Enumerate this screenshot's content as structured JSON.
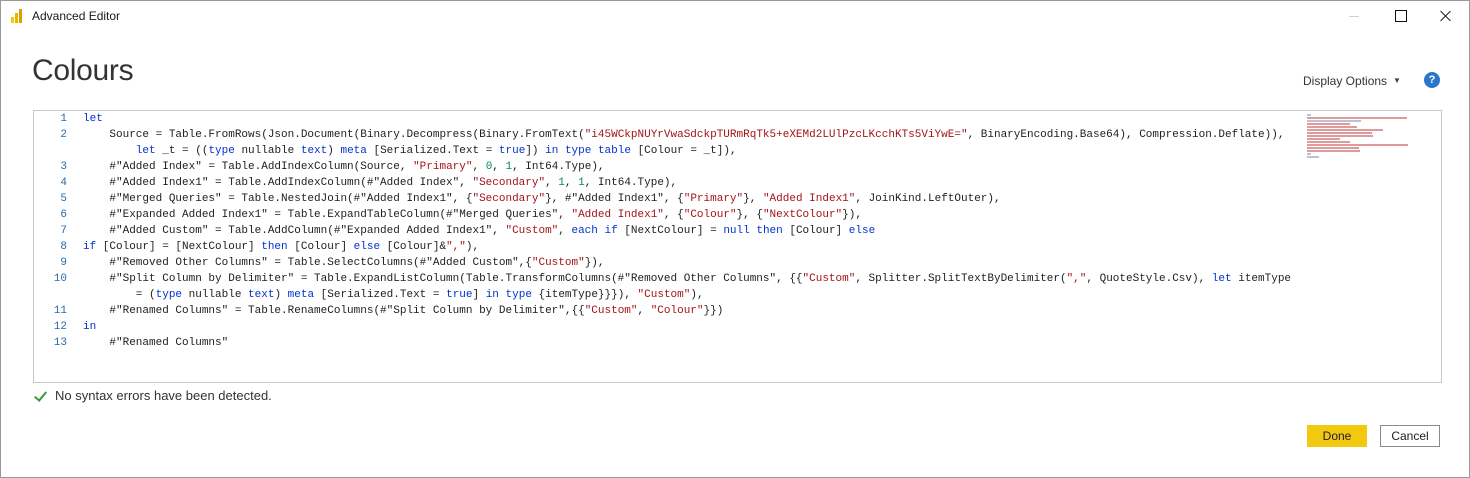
{
  "window": {
    "title": "Advanced Editor"
  },
  "header": {
    "query_name": "Colours",
    "display_options_label": "Display Options",
    "help_icon": "question-circle-icon"
  },
  "editor": {
    "lines": [
      {
        "number": "1",
        "tokens": [
          {
            "t": "kw",
            "v": "let"
          }
        ]
      },
      {
        "number": "2",
        "tokens": [
          {
            "t": "",
            "v": "    Source = Table.FromRows(Json.Document(Binary.Decompress(Binary.FromText("
          },
          {
            "t": "st",
            "v": "\"i45WCkpNUYrVwaSdckpTURmRqTk5+eXEMd2LUlPzcLKcchKTs5ViYwE=\""
          },
          {
            "t": "",
            "v": ", BinaryEncoding.Base64), Compression.Deflate)),"
          }
        ]
      },
      {
        "number": "",
        "tokens": [
          {
            "t": "",
            "v": "        "
          },
          {
            "t": "kw",
            "v": "let"
          },
          {
            "t": "",
            "v": " _t = (("
          },
          {
            "t": "kw",
            "v": "type"
          },
          {
            "t": "",
            "v": " nullable "
          },
          {
            "t": "kw",
            "v": "text"
          },
          {
            "t": "",
            "v": ") "
          },
          {
            "t": "kw",
            "v": "meta"
          },
          {
            "t": "",
            "v": " [Serialized.Text = "
          },
          {
            "t": "kw",
            "v": "true"
          },
          {
            "t": "",
            "v": "]) "
          },
          {
            "t": "kw",
            "v": "in"
          },
          {
            "t": "",
            "v": " "
          },
          {
            "t": "kw",
            "v": "type"
          },
          {
            "t": "",
            "v": " "
          },
          {
            "t": "kw",
            "v": "table"
          },
          {
            "t": "",
            "v": " [Colour = _t]),"
          }
        ]
      },
      {
        "number": "3",
        "tokens": [
          {
            "t": "",
            "v": "    #\"Added Index\" = Table.AddIndexColumn(Source, "
          },
          {
            "t": "st",
            "v": "\"Primary\""
          },
          {
            "t": "",
            "v": ", "
          },
          {
            "t": "nm",
            "v": "0"
          },
          {
            "t": "",
            "v": ", "
          },
          {
            "t": "nm",
            "v": "1"
          },
          {
            "t": "",
            "v": ", Int64.Type),"
          }
        ]
      },
      {
        "number": "4",
        "tokens": [
          {
            "t": "",
            "v": "    #\"Added Index1\" = Table.AddIndexColumn(#\"Added Index\", "
          },
          {
            "t": "st",
            "v": "\"Secondary\""
          },
          {
            "t": "",
            "v": ", "
          },
          {
            "t": "nm",
            "v": "1"
          },
          {
            "t": "",
            "v": ", "
          },
          {
            "t": "nm",
            "v": "1"
          },
          {
            "t": "",
            "v": ", Int64.Type),"
          }
        ]
      },
      {
        "number": "5",
        "tokens": [
          {
            "t": "",
            "v": "    #\"Merged Queries\" = Table.NestedJoin(#\"Added Index1\", {"
          },
          {
            "t": "st",
            "v": "\"Secondary\""
          },
          {
            "t": "",
            "v": "}, #\"Added Index1\", {"
          },
          {
            "t": "st",
            "v": "\"Primary\""
          },
          {
            "t": "",
            "v": "}, "
          },
          {
            "t": "st",
            "v": "\"Added Index1\""
          },
          {
            "t": "",
            "v": ", JoinKind.LeftOuter),"
          }
        ]
      },
      {
        "number": "6",
        "tokens": [
          {
            "t": "",
            "v": "    #\"Expanded Added Index1\" = Table.ExpandTableColumn(#\"Merged Queries\", "
          },
          {
            "t": "st",
            "v": "\"Added Index1\""
          },
          {
            "t": "",
            "v": ", {"
          },
          {
            "t": "st",
            "v": "\"Colour\""
          },
          {
            "t": "",
            "v": "}, {"
          },
          {
            "t": "st",
            "v": "\"NextColour\""
          },
          {
            "t": "",
            "v": "}),"
          }
        ]
      },
      {
        "number": "7",
        "tokens": [
          {
            "t": "",
            "v": "    #\"Added Custom\" = Table.AddColumn(#\"Expanded Added Index1\", "
          },
          {
            "t": "st",
            "v": "\"Custom\""
          },
          {
            "t": "",
            "v": ", "
          },
          {
            "t": "kw",
            "v": "each"
          },
          {
            "t": "",
            "v": " "
          },
          {
            "t": "kw",
            "v": "if"
          },
          {
            "t": "",
            "v": " [NextColour] = "
          },
          {
            "t": "kw",
            "v": "null"
          },
          {
            "t": "",
            "v": " "
          },
          {
            "t": "kw",
            "v": "then"
          },
          {
            "t": "",
            "v": " [Colour] "
          },
          {
            "t": "kw",
            "v": "else"
          }
        ]
      },
      {
        "number": "8",
        "tokens": [
          {
            "t": "kw",
            "v": "if"
          },
          {
            "t": "",
            "v": " [Colour] = [NextColour] "
          },
          {
            "t": "kw",
            "v": "then"
          },
          {
            "t": "",
            "v": " [Colour] "
          },
          {
            "t": "kw",
            "v": "else"
          },
          {
            "t": "",
            "v": " [Colour]&"
          },
          {
            "t": "st",
            "v": "\",\""
          },
          {
            "t": "",
            "v": "),"
          }
        ]
      },
      {
        "number": "9",
        "tokens": [
          {
            "t": "",
            "v": "    #\"Removed Other Columns\" = Table.SelectColumns(#\"Added Custom\",{"
          },
          {
            "t": "st",
            "v": "\"Custom\""
          },
          {
            "t": "",
            "v": "}),"
          }
        ]
      },
      {
        "number": "10",
        "tokens": [
          {
            "t": "",
            "v": "    #\"Split Column by Delimiter\" = Table.ExpandListColumn(Table.TransformColumns(#\"Removed Other Columns\", {{"
          },
          {
            "t": "st",
            "v": "\"Custom\""
          },
          {
            "t": "",
            "v": ", Splitter.SplitTextByDelimiter("
          },
          {
            "t": "st",
            "v": "\",\""
          },
          {
            "t": "",
            "v": ", QuoteStyle.Csv), "
          },
          {
            "t": "kw",
            "v": "let"
          },
          {
            "t": "",
            "v": " itemType"
          }
        ]
      },
      {
        "number": "",
        "tokens": [
          {
            "t": "",
            "v": "        = ("
          },
          {
            "t": "kw",
            "v": "type"
          },
          {
            "t": "",
            "v": " nullable "
          },
          {
            "t": "kw",
            "v": "text"
          },
          {
            "t": "",
            "v": ") "
          },
          {
            "t": "kw",
            "v": "meta"
          },
          {
            "t": "",
            "v": " [Serialized.Text = "
          },
          {
            "t": "kw",
            "v": "true"
          },
          {
            "t": "",
            "v": "] "
          },
          {
            "t": "kw",
            "v": "in"
          },
          {
            "t": "",
            "v": " "
          },
          {
            "t": "kw",
            "v": "type"
          },
          {
            "t": "",
            "v": " {itemType}}}), "
          },
          {
            "t": "st",
            "v": "\"Custom\""
          },
          {
            "t": "",
            "v": "),"
          }
        ]
      },
      {
        "number": "11",
        "tokens": [
          {
            "t": "",
            "v": "    #\"Renamed Columns\" = Table.RenameColumns(#\"Split Column by Delimiter\",{{"
          },
          {
            "t": "st",
            "v": "\"Custom\""
          },
          {
            "t": "",
            "v": ", "
          },
          {
            "t": "st",
            "v": "\"Colour\""
          },
          {
            "t": "",
            "v": "}})"
          }
        ]
      },
      {
        "number": "12",
        "tokens": [
          {
            "t": "kw",
            "v": "in"
          }
        ]
      },
      {
        "number": "13",
        "tokens": [
          {
            "t": "",
            "v": "    #\"Renamed Columns\""
          }
        ]
      }
    ],
    "colors": {
      "keyword": "#0033cc",
      "string": "#a31515",
      "number": "#098658",
      "line_number": "#2b6aa8"
    }
  },
  "status": {
    "icon": "check-icon",
    "text": "No syntax errors have been detected."
  },
  "footer": {
    "done_label": "Done",
    "cancel_label": "Cancel"
  },
  "theme": {
    "accent": "#f2c811",
    "help": "#2a77c9",
    "success": "#3a9c3a"
  }
}
